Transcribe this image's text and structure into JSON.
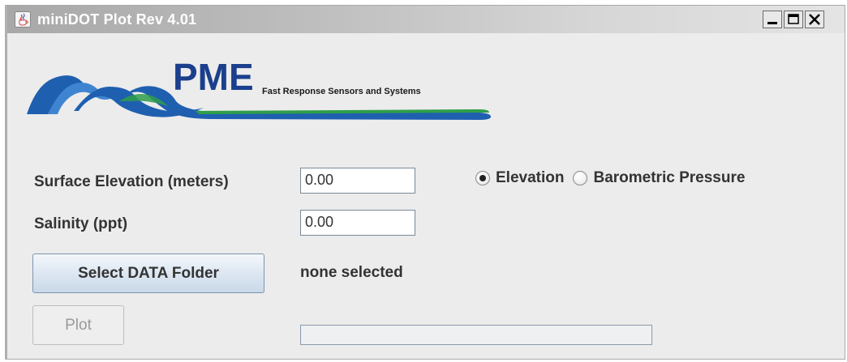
{
  "window": {
    "title": "miniDOT Plot Rev 4.01",
    "app_icon": "java-cup-icon",
    "controls": {
      "minimize_icon": "minimize-icon",
      "maximize_icon": "maximize-icon",
      "close_icon": "close-icon"
    }
  },
  "logo": {
    "brand": "PME",
    "tagline": "Fast Response Sensors and Systems",
    "colors": {
      "wave_blue": "#1f5fb0",
      "wave_green": "#2e9e4a",
      "brand_text": "#1b3f8c"
    }
  },
  "form": {
    "surface_elevation": {
      "label": "Surface Elevation (meters)",
      "value": "0.00"
    },
    "salinity": {
      "label": "Salinity (ppt)",
      "value": "0.00"
    },
    "pressure_mode": {
      "options": [
        {
          "label": "Elevation",
          "checked": true
        },
        {
          "label": "Barometric Pressure",
          "checked": false
        }
      ]
    }
  },
  "actions": {
    "select_folder_label": "Select DATA Folder",
    "folder_status": "none selected",
    "plot_label": "Plot",
    "plot_enabled": false
  },
  "progress": {
    "fraction": 0
  }
}
